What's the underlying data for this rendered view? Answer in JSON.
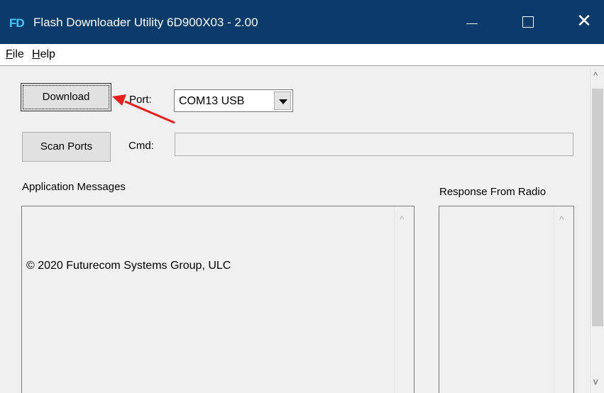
{
  "window": {
    "icon_text": "FD",
    "title": "Flash Downloader Utility 6D900X03 - 2.00",
    "close_glyph": "✕"
  },
  "menu": {
    "file_accel": "F",
    "file_rest": "ile",
    "help_accel": "H",
    "help_rest": "elp"
  },
  "buttons": {
    "download": "Download",
    "scan_ports": "Scan Ports"
  },
  "port": {
    "label": "Port:",
    "selected": "COM13 USB"
  },
  "cmd": {
    "label": "Cmd:",
    "value": ""
  },
  "application_messages": {
    "label": "Application Messages",
    "text": "© 2020 Futurecom Systems Group, ULC"
  },
  "response_from_radio": {
    "label": "Response From Radio",
    "text": ""
  },
  "colors": {
    "titlebar": "#0b3b6b",
    "annotation_arrow": "#e8201c"
  }
}
